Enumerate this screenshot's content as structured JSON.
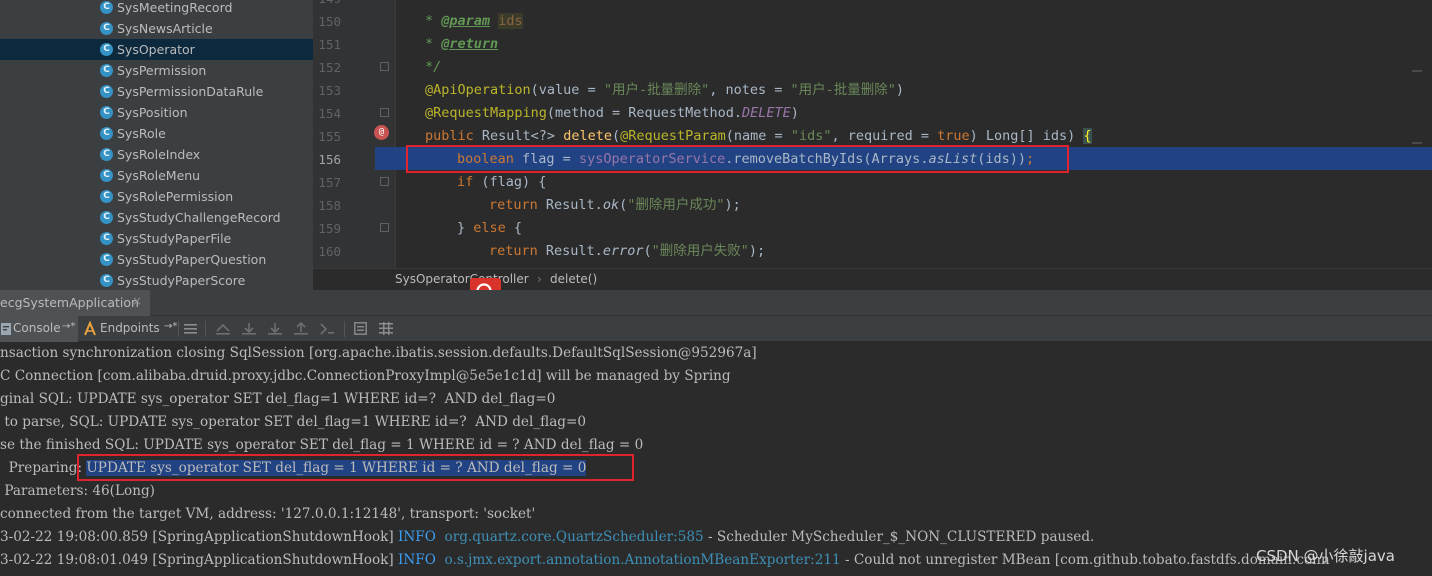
{
  "project_tree": {
    "items": [
      {
        "label": "SysMeetingRecord"
      },
      {
        "label": "SysNewsArticle"
      },
      {
        "label": "SysOperator",
        "selected": true
      },
      {
        "label": "SysPermission"
      },
      {
        "label": "SysPermissionDataRule"
      },
      {
        "label": "SysPosition"
      },
      {
        "label": "SysRole"
      },
      {
        "label": "SysRoleIndex"
      },
      {
        "label": "SysRoleMenu"
      },
      {
        "label": "SysRolePermission"
      },
      {
        "label": "SysStudyChallengeRecord"
      },
      {
        "label": "SysStudyPaperFile"
      },
      {
        "label": "SysStudyPaperQuestion"
      },
      {
        "label": "SysStudyPaperScore"
      }
    ],
    "class_icon_letter": "C"
  },
  "editor": {
    "line_numbers": [
      "149",
      "150",
      "151",
      "152",
      "153",
      "154",
      "155",
      "156",
      "157",
      "158",
      "159",
      "160"
    ],
    "current_line": "156",
    "tokens": {
      "l150_star": "* ",
      "l150_tag": "@param",
      "l150_ids": "ids",
      "l151_star": "* ",
      "l151_tag": "@return",
      "l152_end": "*/",
      "l153_ann": "@ApiOperation",
      "l153_open": "(value = ",
      "l153_s1": "\"用户-批量删除\"",
      "l153_mid": ", notes = ",
      "l153_s2": "\"用户-批量删除\"",
      "l153_close": ")",
      "l154_ann": "@RequestMapping",
      "l154_open": "(method = RequestMethod.",
      "l154_const": "DELETE",
      "l154_close": ")",
      "l155_public": "public ",
      "l155_type": "Result<?> ",
      "l155_name": "delete",
      "l155_open": "(",
      "l155_ann": "@RequestParam",
      "l155_p1": "(name = ",
      "l155_s": "\"ids\"",
      "l155_p2": ", required = ",
      "l155_true": "true",
      "l155_p3": ") Long[] ids) ",
      "l155_brace": "{",
      "l156_bool": "boolean ",
      "l156_var": "flag = ",
      "l156_field": "sysOperatorService",
      "l156_call": ".removeBatchByIds(Arrays.",
      "l156_aslist": "asList",
      "l156_args": "(ids))",
      "l156_semi": ";",
      "l157_if": "if ",
      "l157_cond": "(flag) {",
      "l158_ret": "return ",
      "l158_res": "Result.",
      "l158_ok": "ok",
      "l158_open": "(",
      "l158_s": "\"删除用户成功\"",
      "l158_close": ");",
      "l159_brace": "} ",
      "l159_else": "else ",
      "l159_open": "{",
      "l160_ret": "return ",
      "l160_res": "Result.",
      "l160_err": "error",
      "l160_open": "(",
      "l160_s": "\"删除用户失败\"",
      "l160_close": ");"
    }
  },
  "breadcrumb": {
    "class_name": "SysOperatorController",
    "method": "delete()",
    "separator": "›"
  },
  "run_panel": {
    "tab_label": "ecgSystemApplication",
    "close_glyph": "×",
    "console_label": "Console",
    "endpoints_label": "Endpoints",
    "pin_glyph": "→*"
  },
  "console": {
    "lines": [
      {
        "text": "nsaction synchronization closing SqlSession [org.apache.ibatis.session.defaults.DefaultSqlSession@952967a]"
      },
      {
        "text": "C Connection [com.alibaba.druid.proxy.jdbc.ConnectionProxyImpl@5e5e1c1d] will be managed by Spring"
      },
      {
        "text": "ginal SQL: UPDATE sys_operator SET del_flag=1 WHERE id=?  AND del_flag=0"
      },
      {
        "text": " to parse, SQL: UPDATE sys_operator SET del_flag=1 WHERE id=?  AND del_flag=0"
      },
      {
        "text": "se the finished SQL: UPDATE sys_operator SET del_flag = 1 WHERE id = ? AND del_flag = 0"
      }
    ],
    "preparing_prefix": "  Preparing: ",
    "preparing_sql": "UPDATE sys_operator SET del_flag = 1 WHERE id = ? AND del_flag = 0",
    "parameters": " Parameters: 46(Long)",
    "disconnected": "connected from the target VM, address: '127.0.0.1:12148', transport: 'socket'",
    "log1_time": "3-02-22 19:08:00.859 [SpringApplicationShutdownHook] ",
    "log1_level": "INFO",
    "log1_class": "org.quartz.core.QuartzScheduler:585",
    "log1_msg": " - Scheduler MyScheduler_$_NON_CLUSTERED paused.",
    "log2_time": "3-02-22 19:08:01.049 [SpringApplicationShutdownHook] ",
    "log2_level": "INFO",
    "log2_class": "o.s.jmx.export.annotation.AnnotationMBeanExporter:211",
    "log2_msg": " - Could not unregister MBean [com.github.tobato.fastdfs.domain.conn"
  },
  "watermark": "CSDN @小徐敲java"
}
